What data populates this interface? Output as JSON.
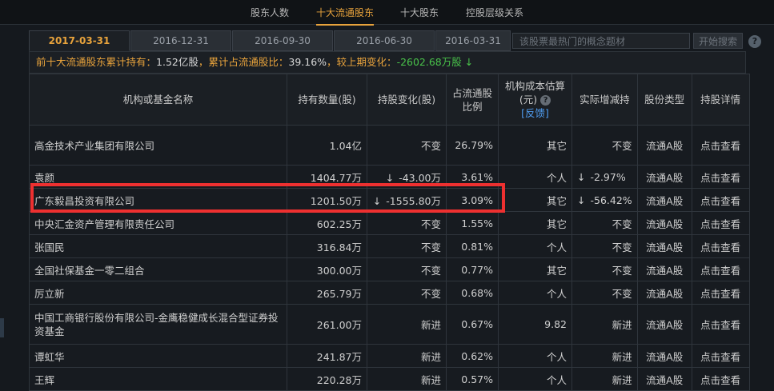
{
  "nav": {
    "items": [
      {
        "label": "股东人数"
      },
      {
        "label": "十大流通股东",
        "active": true
      },
      {
        "label": "十大股东"
      },
      {
        "label": "控股层级关系"
      }
    ]
  },
  "date_tabs": [
    "2017-03-31",
    "2016-12-31",
    "2016-09-30",
    "2016-06-30",
    "2016-03-31"
  ],
  "search": {
    "placeholder": "该股票最热门的概念题材",
    "button": "开始搜索",
    "help": "?"
  },
  "summary": {
    "label1": "前十大流通股东累计持有：",
    "value1": "1.52亿股",
    "label2": "，累计占流通股比：",
    "value2": "39.16%",
    "label3": "，较上期变化：",
    "value3": "-2602.68万股",
    "arrow": "↓"
  },
  "table": {
    "headers": {
      "name": "机构或基金名称",
      "qty": "持有数量(股)",
      "chg": "持股变化(股)",
      "ratio": "占流通股比例",
      "cost": "机构成本估算(元)",
      "feedback": "[反馈]",
      "real": "实际增减持",
      "type": "股份类型",
      "detail": "持股详情"
    },
    "rows": [
      {
        "name": "高金技术产业集团有限公司",
        "qty": "1.04亿",
        "chg": "不变",
        "chg_kind": "neutral",
        "ratio": "26.79%",
        "cost": "其它",
        "real": "不变",
        "real_kind": "neutral",
        "type": "流通A股",
        "link": "点击查看"
      },
      {
        "name": "袁颜",
        "qty": "1404.77万",
        "chg": "-43.00万",
        "chg_kind": "neg",
        "ratio": "3.61%",
        "cost": "个人",
        "real": "-2.97%",
        "real_kind": "neg",
        "type": "流通A股",
        "link": "点击查看"
      },
      {
        "name": "广东毅昌投资有限公司",
        "qty": "1201.50万",
        "chg": "-1555.80万",
        "chg_kind": "neg",
        "ratio": "3.09%",
        "cost": "其它",
        "real": "-56.42%",
        "real_kind": "neg",
        "type": "流通A股",
        "link": "点击查看"
      },
      {
        "name": "中央汇金资产管理有限责任公司",
        "qty": "602.25万",
        "chg": "不变",
        "chg_kind": "neutral",
        "ratio": "1.55%",
        "cost": "其它",
        "real": "不变",
        "real_kind": "neutral",
        "type": "流通A股",
        "link": "点击查看"
      },
      {
        "name": "张国民",
        "qty": "316.84万",
        "chg": "不变",
        "chg_kind": "neutral",
        "ratio": "0.81%",
        "cost": "个人",
        "real": "不变",
        "real_kind": "neutral",
        "type": "流通A股",
        "link": "点击查看"
      },
      {
        "name": "全国社保基金一零二组合",
        "qty": "300.00万",
        "chg": "不变",
        "chg_kind": "neutral",
        "ratio": "0.77%",
        "cost": "其它",
        "real": "不变",
        "real_kind": "neutral",
        "type": "流通A股",
        "link": "点击查看"
      },
      {
        "name": "厉立新",
        "qty": "265.79万",
        "chg": "不变",
        "chg_kind": "neutral",
        "ratio": "0.68%",
        "cost": "个人",
        "real": "不变",
        "real_kind": "neutral",
        "type": "流通A股",
        "link": "点击查看"
      },
      {
        "name": "中国工商银行股份有限公司-金鹰稳健成长混合型证券投资基金",
        "qty": "261.00万",
        "chg": "新进",
        "chg_kind": "newin",
        "ratio": "0.67%",
        "cost": "9.82",
        "real": "新进",
        "real_kind": "newin",
        "type": "流通A股",
        "link": "点击查看"
      },
      {
        "name": "谭虹华",
        "qty": "241.87万",
        "chg": "新进",
        "chg_kind": "newin",
        "ratio": "0.62%",
        "cost": "个人",
        "real": "新进",
        "real_kind": "newin",
        "type": "流通A股",
        "link": "点击查看"
      },
      {
        "name": "王辉",
        "qty": "220.28万",
        "chg": "新进",
        "chg_kind": "newin",
        "ratio": "0.57%",
        "cost": "个人",
        "real": "新进",
        "real_kind": "newin",
        "type": "流通A股",
        "link": "点击查看"
      }
    ],
    "down_arrow": "↓"
  },
  "colors": {
    "accent": "#e8a33c",
    "negative": "#49c24a",
    "new": "#ff3b3b",
    "link": "#4f9cf0",
    "highlight": "#ee3030"
  }
}
